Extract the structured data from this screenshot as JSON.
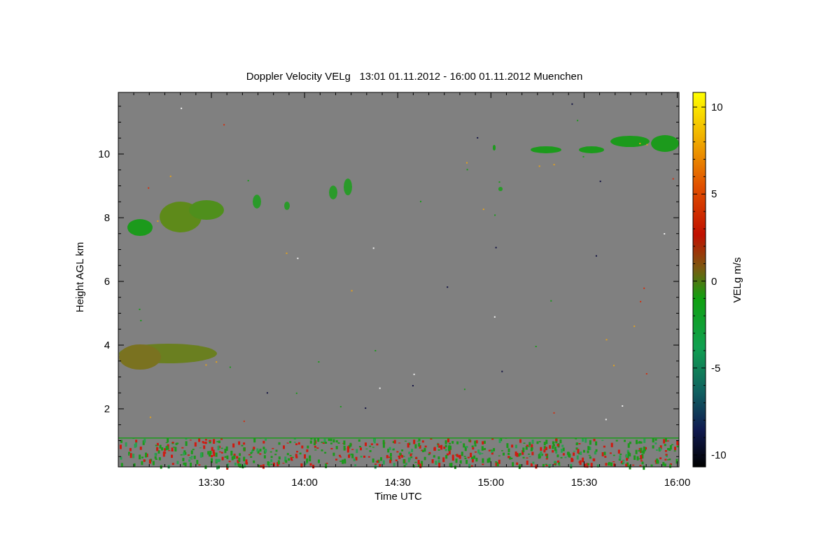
{
  "figure": {
    "title": "Doppler Velocity VELg   13:01 01.11.2012 - 16:00 01.11.2012 Muenchen",
    "xlabel": "Time UTC",
    "ylabel": "Height AGL km",
    "xticks": [
      "13:30",
      "14:00",
      "14:30",
      "15:00",
      "15:30",
      "16:00"
    ],
    "yticks": [
      "10",
      "8",
      "6",
      "4",
      "2"
    ],
    "colorbar": {
      "label": "VELg m/s",
      "ticks": [
        "10",
        "5",
        "0",
        "-5",
        "-10"
      ]
    }
  }
}
